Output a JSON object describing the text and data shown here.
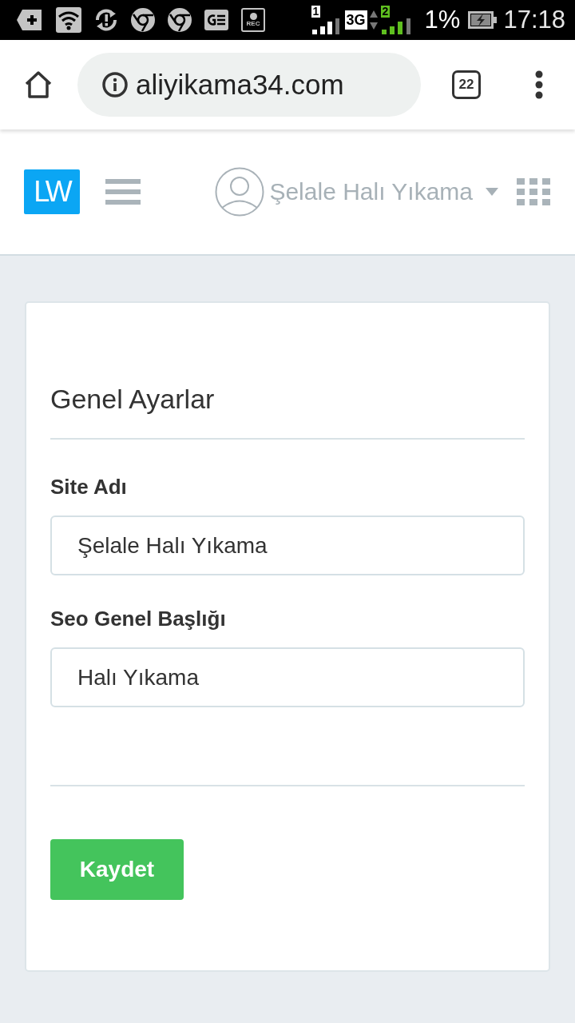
{
  "status_bar": {
    "rec_label": "REC",
    "sim1_label": "1",
    "network_type": "3G",
    "sim2_label": "2",
    "battery": "1%",
    "time": "17:18"
  },
  "browser": {
    "url": "aliyikama34.com",
    "tab_count": "22"
  },
  "header": {
    "logo": "LW",
    "user_name": "Şelale Halı Yıkama"
  },
  "card": {
    "title": "Genel Ayarlar",
    "fields": [
      {
        "label": "Site Adı",
        "value": "Şelale Halı Yıkama"
      },
      {
        "label": "Seo Genel Başlığı",
        "value": "Halı Yıkama"
      }
    ],
    "buttons": [
      {
        "label": "Kaydet"
      }
    ]
  }
}
